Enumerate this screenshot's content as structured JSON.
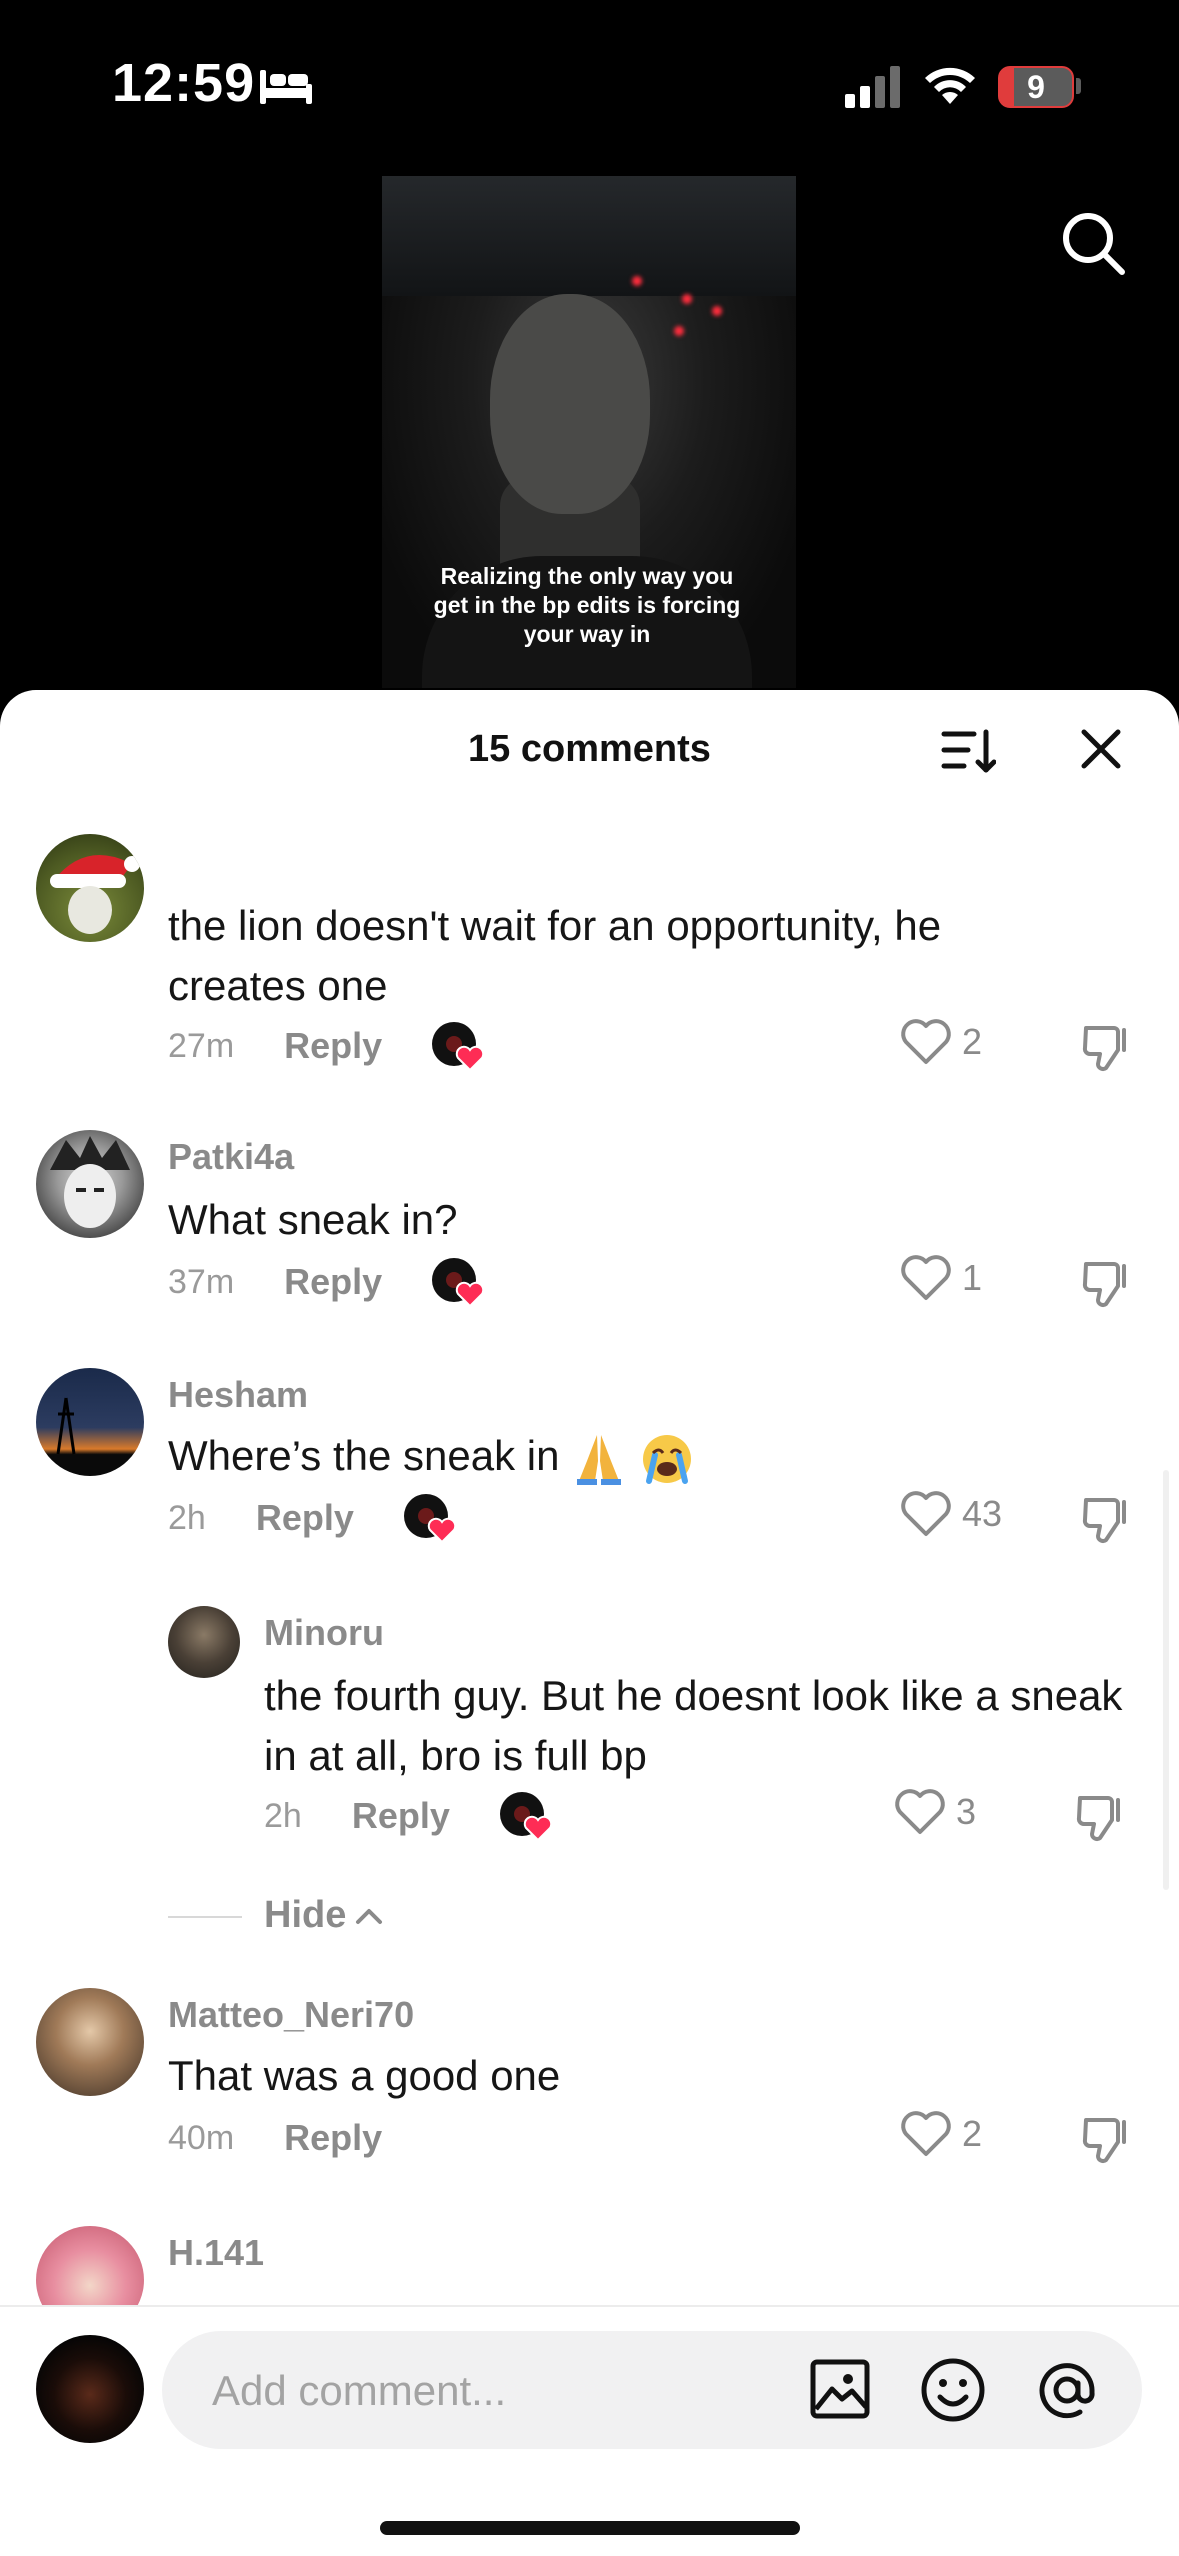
{
  "status_bar": {
    "time": "12:59",
    "battery": "9"
  },
  "video": {
    "caption": "Realizing the only way you get in the bp edits is forcing your way in"
  },
  "sheet": {
    "title": "15 comments"
  },
  "comments": [
    {
      "username": "",
      "text": "the lion doesn't wait for an opportunity, he creates one",
      "time": "27m",
      "reply": "Reply",
      "likes": "2"
    },
    {
      "username": "Patki4a",
      "text": "What sneak in?",
      "time": "37m",
      "reply": "Reply",
      "likes": "1"
    },
    {
      "username": "Hesham",
      "text": "Where’s the sneak in",
      "time": "2h",
      "reply": "Reply",
      "likes": "43"
    },
    {
      "username": "Minoru",
      "text": "the fourth guy. But he doesnt look like a sneak in at all, bro is full bp",
      "time": "2h",
      "reply": "Reply",
      "likes": "3"
    },
    {
      "username": "Matteo_Neri70",
      "text": "That was a good one",
      "time": "40m",
      "reply": "Reply",
      "likes": "2"
    },
    {
      "username": "H.141"
    }
  ],
  "hide_label": "Hide",
  "input": {
    "placeholder": "Add comment..."
  },
  "icons": [
    "bed-icon",
    "signal-icon",
    "wifi-icon",
    "search-icon",
    "sort-icon",
    "close-icon",
    "heart-icon",
    "dislike-icon",
    "image-icon",
    "emoji-icon",
    "at-icon"
  ],
  "colors": {
    "accent": "#fe2c55",
    "muted": "#8a8a8a",
    "battery_low": "#e03c3c"
  }
}
